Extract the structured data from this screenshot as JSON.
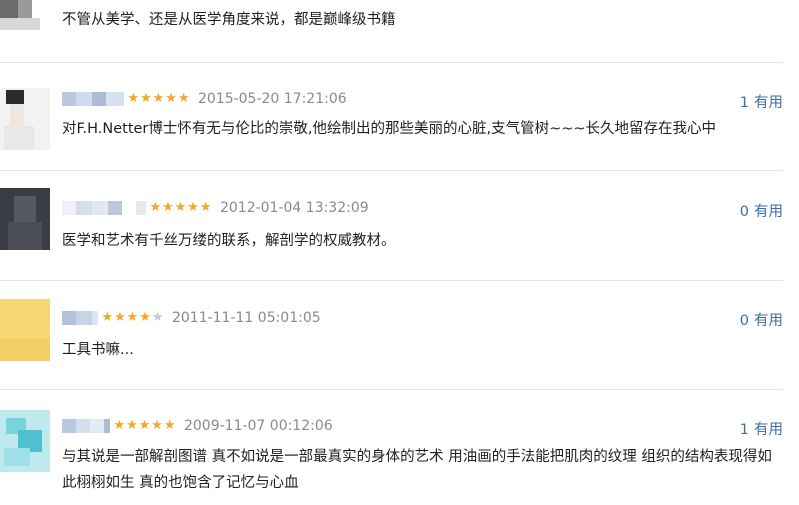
{
  "top_review": {
    "content": "不管从美学、还是从医学角度来说，都是巅峰级书籍"
  },
  "reviews": [
    {
      "stars": 5,
      "timestamp": "2015-05-20 17:21:06",
      "useful_count": "1",
      "useful_label": "有用",
      "content": "对F.H.Netter博士怀有无与伦比的崇敬,他绘制出的那些美丽的心脏,支气管树~~~长久地留存在我心中"
    },
    {
      "stars": 5,
      "timestamp": "2012-01-04 13:32:09",
      "useful_count": "0",
      "useful_label": "有用",
      "content": "医学和艺术有千丝万缕的联系，解剖学的权威教材。"
    },
    {
      "stars": 4,
      "timestamp": "2011-11-11 05:01:05",
      "useful_count": "0",
      "useful_label": "有用",
      "content": "工具书嘛..."
    },
    {
      "stars": 5,
      "timestamp": "2009-11-07 00:12:06",
      "useful_count": "1",
      "useful_label": "有用",
      "content": "与其说是一部解剖图谱 真不如说是一部最真实的身体的艺术 用油画的手法能把肌肉的纹理 组织的结构表现得如此栩栩如生 真的也饱含了记忆与心血"
    }
  ],
  "colors": {
    "star": "#f5a623",
    "star_empty": "#c9c9c9",
    "useful_link": "#3b6ea5",
    "timestamp": "#8a8a8a",
    "divider": "#e6e6e6"
  }
}
